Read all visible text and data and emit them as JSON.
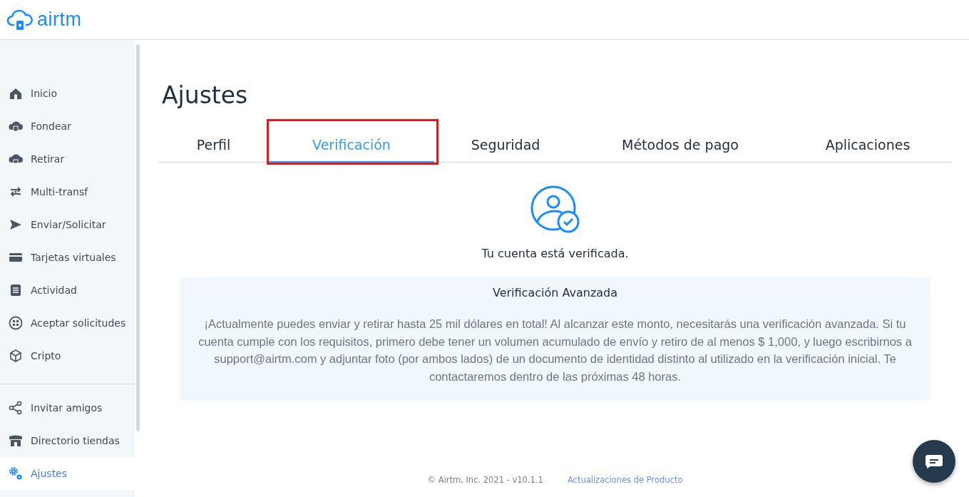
{
  "header": {
    "logo_text": "airtm"
  },
  "sidebar": {
    "main_items": [
      {
        "label": "Inicio",
        "selected": false
      },
      {
        "label": "Fondear",
        "selected": false
      },
      {
        "label": "Retirar",
        "selected": false
      },
      {
        "label": "Multi-transf",
        "selected": false
      },
      {
        "label": "Enviar/Solicitar",
        "selected": false
      },
      {
        "label": "Tarjetas virtuales",
        "selected": false
      },
      {
        "label": "Actividad",
        "selected": false
      },
      {
        "label": "Aceptar solicitudes",
        "selected": false
      },
      {
        "label": "Cripto",
        "selected": false
      }
    ],
    "extra_items": [
      {
        "label": "Invitar amigos",
        "selected": false
      },
      {
        "label": "Directorio tiendas",
        "selected": false
      },
      {
        "label": "Ajustes",
        "selected": true
      }
    ]
  },
  "page_title": "Ajustes",
  "tabs": [
    {
      "label": "Perfil",
      "selected": false,
      "highlighted": false
    },
    {
      "label": "Verificación",
      "selected": true,
      "highlighted": true
    },
    {
      "label": "Seguridad",
      "selected": false,
      "highlighted": false
    },
    {
      "label": "Métodos de pago",
      "selected": false,
      "highlighted": false
    },
    {
      "label": "Aplicaciones",
      "selected": false,
      "highlighted": false
    }
  ],
  "status": {
    "verified": true,
    "message": "Tu cuenta está verificada."
  },
  "info_card": {
    "title": "Verificación Avanzada",
    "body": "¡Actualmente puedes enviar y retirar hasta 25 mil dólares en total! Al alcanzar este monto, necesitarás una verificación avanzada. Si tu cuenta cumple con los requisitos, primero debe tener un volumen acumulado de envío y retiro de al menos $ 1,000, y luego escribirnos a support@airtm.com y adjuntar foto (por ambos lados) de un documento de identidad distinto al utilizado en la verificación inicial. Te contactaremos dentro de las próximas 48 horas."
  },
  "footer": {
    "copyright": "© Airtm, Inc. 2021 - v10.1.1",
    "link": "Actualizaciones de Producto"
  }
}
